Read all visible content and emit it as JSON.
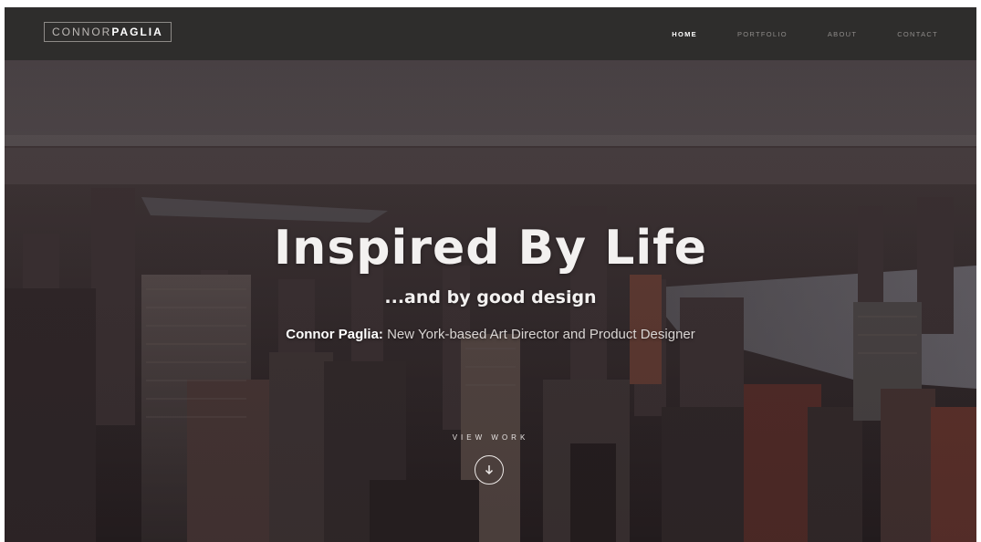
{
  "brand": {
    "logo_light": "CONNOR",
    "logo_bold": "PAGLIA"
  },
  "nav": {
    "items": [
      {
        "label": "HOME",
        "active": true
      },
      {
        "label": "PORTFOLIO",
        "active": false
      },
      {
        "label": "ABOUT",
        "active": false
      },
      {
        "label": "CONTACT",
        "active": false
      }
    ]
  },
  "hero": {
    "headline": "Inspired By Life",
    "subheadline": "...and by good design",
    "tagline_name": "Connor Paglia:",
    "tagline_text": " New York-based Art Director and Product Designer",
    "cta_label": "VIEW WORK",
    "cta_icon": "arrow-down-circle-icon",
    "background": "city-skyline-photo"
  },
  "colors": {
    "navbar_bg": "#2e2d2c",
    "nav_active": "#ffffff",
    "nav_inactive": "#8e8b89"
  }
}
